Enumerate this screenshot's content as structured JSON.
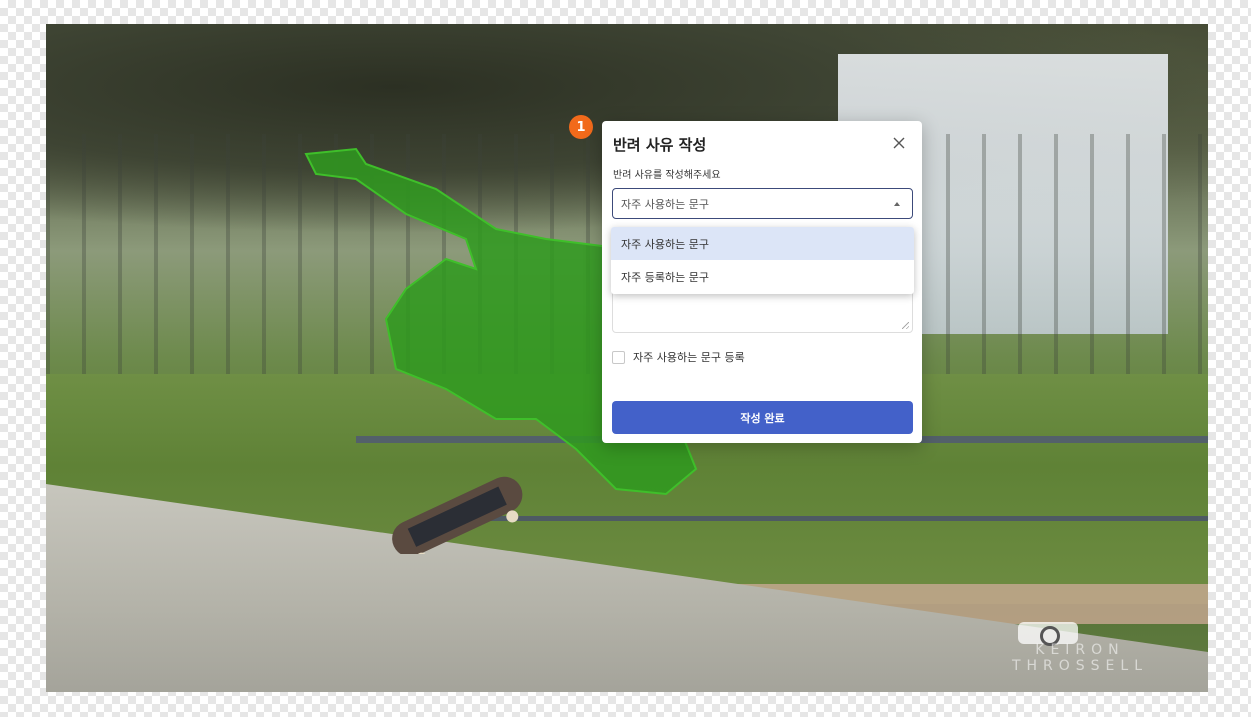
{
  "dialog": {
    "step_badge": "1",
    "title": "반려 사유 작성",
    "subtitle": "반려 사유를 작성해주세요",
    "select_value": "자주 사용하는 문구",
    "dropdown_options": [
      {
        "label": "자주 사용하는 문구",
        "selected": true
      },
      {
        "label": "자주 등록하는 문구",
        "selected": false
      }
    ],
    "checkbox_label": "자주 사용하는 문구 등록",
    "submit_label": "작성 완료"
  },
  "photo": {
    "watermark_line1": "KEIRON",
    "watermark_line2": "THROSSELL"
  },
  "colors": {
    "accent": "#4361c9",
    "badge": "#f26a1b",
    "mask": "#2f9a1f",
    "select_border": "#3c4a7a",
    "option_highlight": "#dce5f7"
  }
}
